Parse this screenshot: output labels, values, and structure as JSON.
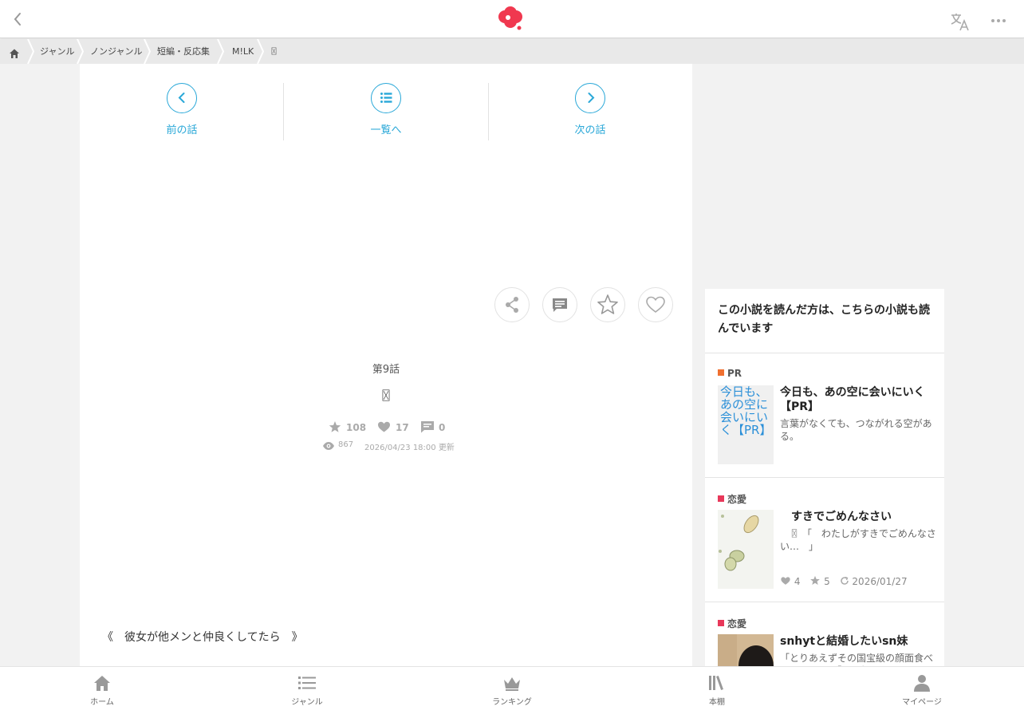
{
  "header": {
    "back_icon": "chevron-left-icon",
    "logo_icon": "app-logo",
    "translate_icon": "translate-icon",
    "more_icon": "more-dots-icon",
    "brand_color": "#f0384f"
  },
  "breadcrumb": {
    "home_icon": "home-icon",
    "items": [
      "ジャンル",
      "ノンジャンル",
      "短編・反応集",
      "M!LK",
      "〿"
    ]
  },
  "episode_nav": {
    "prev_label": "前の話",
    "list_label": "一覧へ",
    "next_label": "次の話",
    "accent": "#2aa8d8"
  },
  "actions": [
    "share-icon",
    "comment-icon",
    "star-icon",
    "heart-icon"
  ],
  "episode": {
    "number": "第9話",
    "title": "〿",
    "stars": "108",
    "likes": "17",
    "comments": "0",
    "views": "867",
    "updated": "2026/04/23 18:00 更新"
  },
  "foreword": "《　彼女が他メンと仲良くしてたら　》",
  "sidebar": {
    "heading": "この小説を読んだ方は、こちらの小説も読んでいます",
    "cards": [
      {
        "genre": "PR",
        "genre_color": "#f07030",
        "thumb_alt": "今日も、あの空に会いにいく【PR】",
        "title": "今日も、あの空に会いにいく【PR】",
        "desc": "言葉がなくても、つながれる空がある。"
      },
      {
        "genre": "恋愛",
        "genre_color": "#e8385a",
        "title": "　すきでごめんなさい",
        "desc": "　〿 「　わたしがすきでごめんなさい…　」",
        "likes": "4",
        "stars": "5",
        "date": "2026/01/27"
      },
      {
        "genre": "恋愛",
        "genre_color": "#e8385a",
        "title": "snhytと結婚したいsn妹",
        "desc": "「とりあえずその国宝級の顔面食べてもいい？」「よし帰っ"
      }
    ]
  },
  "bottom_nav": {
    "items": [
      {
        "label": "ホーム",
        "icon": "home-icon"
      },
      {
        "label": "ジャンル",
        "icon": "list-icon"
      },
      {
        "label": "ランキング",
        "icon": "crown-icon"
      },
      {
        "label": "本棚",
        "icon": "bookshelf-icon"
      },
      {
        "label": "マイページ",
        "icon": "person-icon"
      }
    ]
  }
}
